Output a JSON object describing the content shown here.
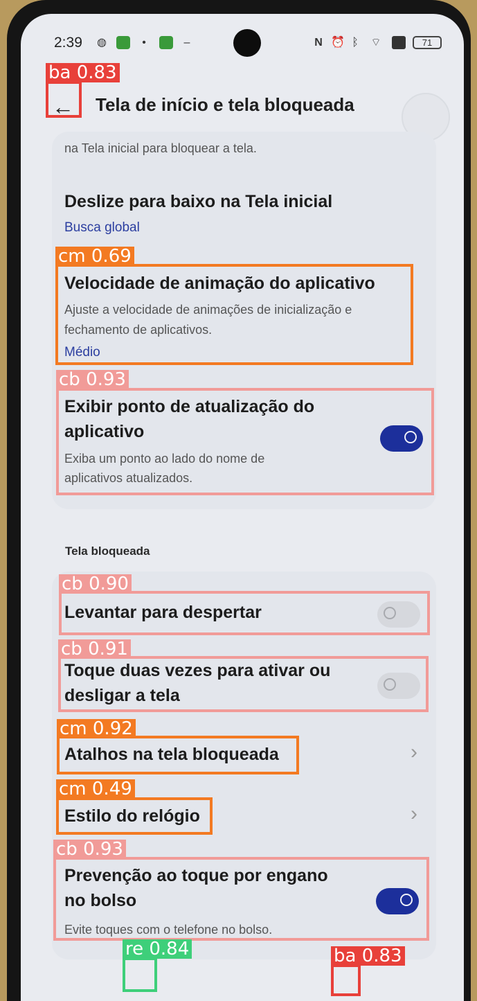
{
  "status_bar": {
    "time": "2:39",
    "battery": "71",
    "left_icons": [
      "mobile-icon",
      "app-green-icon",
      "dot-icon",
      "app-green-icon-2",
      "minus-icon"
    ],
    "right_icons": [
      "nfc-icon",
      "alarm-icon",
      "bluetooth-icon",
      "wifi-icon",
      "sim-icon",
      "battery-icon"
    ]
  },
  "header": {
    "title": "Tela de início e tela bloqueada",
    "back_icon": "arrow-left-icon"
  },
  "settings": {
    "clipped_text": "na Tela inicial para bloquear a tela.",
    "swipe_down": {
      "title": "Deslize para baixo na Tela inicial",
      "value": "Busca global"
    },
    "animation_speed": {
      "title": "Velocidade de animação do aplicativo",
      "desc_line1": "Ajuste a velocidade de animações de inicialização e",
      "desc_line2": "fechamento de aplicativos.",
      "value": "Médio"
    },
    "update_dot": {
      "title_line1": "Exibir ponto de atualização do",
      "title_line2": "aplicativo",
      "desc_line1": "Exiba um ponto ao lado do nome de",
      "desc_line2": "aplicativos atualizados.",
      "enabled": true
    }
  },
  "lock_screen": {
    "section_title": "Tela bloqueada",
    "raise_to_wake": {
      "title": "Levantar para despertar",
      "enabled": false
    },
    "double_tap": {
      "title_line1": "Toque duas vezes para ativar ou",
      "title_line2": "desligar a tela",
      "enabled": false
    },
    "shortcuts": {
      "title": "Atalhos na tela bloqueada"
    },
    "clock_style": {
      "title": "Estilo do relógio"
    },
    "pocket_mode": {
      "title_line1": "Prevenção ao toque por engano",
      "title_line2": "no bolso",
      "desc": "Evite toques com o telefone no bolso.",
      "enabled": true
    }
  },
  "detections": [
    {
      "label": "ba 0.83",
      "color": "#e8403a"
    },
    {
      "label": "cm 0.69",
      "color": "#f37a22"
    },
    {
      "label": "cb 0.93",
      "color": "#f19b98"
    },
    {
      "label": "cb 0.90",
      "color": "#f19b98"
    },
    {
      "label": "cb 0.91",
      "color": "#f19b98"
    },
    {
      "label": "cm 0.92",
      "color": "#f37a22"
    },
    {
      "label": "cm 0.49",
      "color": "#f37a22"
    },
    {
      "label": "cb 0.93",
      "color": "#f19b98"
    },
    {
      "label": "re 0.84",
      "color": "#3ecf7a"
    },
    {
      "label": "ba 0.83",
      "color": "#e8403a"
    }
  ],
  "colors": {
    "accent": "#1c2f9b",
    "screen_bg": "#e9ebf0",
    "card_bg": "#e3e6ec"
  }
}
